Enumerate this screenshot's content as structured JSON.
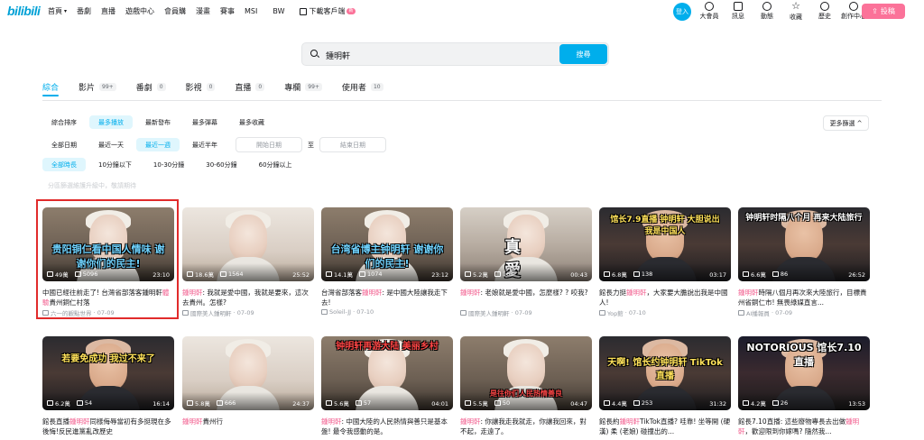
{
  "header": {
    "logo": "bilibili",
    "nav": [
      "首頁",
      "番劇",
      "直播",
      "遊戲中心",
      "會員購",
      "漫畫",
      "賽事",
      "MSI",
      "BW"
    ],
    "download": "下載客戶端",
    "download_badge": "新",
    "login": "登入",
    "right_nav": [
      "大會員",
      "訊息",
      "動態",
      "收藏",
      "歷史",
      "創作中心"
    ],
    "upload": "投稿"
  },
  "search": {
    "value": "鍾明軒",
    "button": "搜尋"
  },
  "tabs": [
    {
      "label": "綜合",
      "count": ""
    },
    {
      "label": "影片",
      "count": "99+"
    },
    {
      "label": "番劇",
      "count": "0"
    },
    {
      "label": "影視",
      "count": "0"
    },
    {
      "label": "直播",
      "count": "0"
    },
    {
      "label": "專欄",
      "count": "99+"
    },
    {
      "label": "使用者",
      "count": "10"
    }
  ],
  "filters": {
    "sort": [
      "綜合排序",
      "最多播放",
      "最新發布",
      "最多彈幕",
      "最多收藏"
    ],
    "date": [
      "全部日期",
      "最近一天",
      "最近一週",
      "最近半年"
    ],
    "date_start": "開始日期",
    "date_to": "至",
    "date_end": "結束日期",
    "duration": [
      "全部時長",
      "10分鐘以下",
      "10-30分鐘",
      "30-60分鐘",
      "60分鐘以上"
    ],
    "more": "更多篩選",
    "hint": "分區篩選維護升級中，敬請期待"
  },
  "cards_row1": [
    {
      "plays": "49萬",
      "danmaku": "5096",
      "duration": "23:10",
      "overlay": "贵阳铜仁看中国人情味 谢谢你们的民主!",
      "title_pre": "中國已經往前走了! 台灣省部落客鍾明軒",
      "title_hl": "體驗",
      "title_post": "貴州銅仁村落",
      "author": "六一的觀點世界",
      "date": "07-09"
    },
    {
      "plays": "18.6萬",
      "danmaku": "1564",
      "duration": "25:52",
      "overlay": "",
      "title_pre": "",
      "title_hl": "鍾明軒",
      "title_post": ": 我就是愛中國，我就是要來，這次去貴州。怎樣?",
      "author": "國際美人鍾明軒",
      "date": "07-09"
    },
    {
      "plays": "14.1萬",
      "danmaku": "1074",
      "duration": "23:12",
      "overlay": "台湾省博主钟明轩 谢谢你们的民主!",
      "title_pre": "台灣省部落客",
      "title_hl": "鍾明軒",
      "title_post": ": 是中國大陸讓我走下去!",
      "author": "Soleil-JJ",
      "date": "07-10"
    },
    {
      "plays": "5.2萬",
      "danmaku": "163",
      "duration": "00:43",
      "overlay": "真 愛 我的中国心",
      "title_pre": "",
      "title_hl": "鍾明軒",
      "title_post": ": 老娘就是愛中國，怎麼樣? ? 咬我?",
      "author": "國際美人鍾明軒",
      "date": "07-09"
    },
    {
      "plays": "6.8萬",
      "danmaku": "138",
      "duration": "03:17",
      "overlay": "馆长7.9直播 钟明轩 大胆说出我是中国人",
      "title_pre": "館長力挺",
      "title_hl": "鍾明軒",
      "title_post": "，大家要大膽說出我是中國人!",
      "author": "Yop館",
      "date": "07-10"
    },
    {
      "plays": "6.6萬",
      "danmaku": "86",
      "duration": "26:52",
      "overlay": "钟明轩时隔八个月 再来大陆旅行",
      "title_pre": "",
      "title_hl": "鍾明軒",
      "title_post": "時隔八個月再次來大陸旅行，目標貴州省銅仁市! 無畏綠媒直言...",
      "author": "AI播報員",
      "date": "07-09"
    }
  ],
  "cards_row2": [
    {
      "plays": "6.2萬",
      "danmaku": "54",
      "duration": "16:14",
      "overlay": "若要免成功 我过不来了",
      "title_pre": "館長直播",
      "title_hl": "鍾明軒",
      "title_post": "同樣侮辱當初有多挺現在多後悔!反民進黨亂改歷史",
      "author": "",
      "date": ""
    },
    {
      "plays": "5.8萬",
      "danmaku": "666",
      "duration": "24:37",
      "overlay": "",
      "title_pre": "",
      "title_hl": "鍾明軒",
      "title_post": "貴州行",
      "author": "",
      "date": ""
    },
    {
      "plays": "5.6萬",
      "danmaku": "57",
      "duration": "04:01",
      "overlay": "钟明轩再游大陆 美丽乡村",
      "title_pre": "",
      "title_hl": "鍾明軒",
      "title_post": ": 中國大陸的人民熱情與善只是基本盤! 最令我感動的是。",
      "author": "",
      "date": ""
    },
    {
      "plays": "5.5萬",
      "danmaku": "50",
      "duration": "04:47",
      "overlay": "是往你们人民热情善良",
      "title_pre": "",
      "title_hl": "鍾明軒",
      "title_post": ": 你讓我走我就走，你讓我回來，對不起，走遠了。",
      "author": "",
      "date": ""
    },
    {
      "plays": "4.4萬",
      "danmaku": "253",
      "duration": "31:32",
      "overlay": "天啊! 馆长约钟明轩 TikTok直播",
      "title_pre": "館長約",
      "title_hl": "鍾明軒",
      "title_post": "TikTok直播? 哇靠! 坐等開 (硬漢) 柔 (老娘) 碰撞出的...",
      "author": "",
      "date": ""
    },
    {
      "plays": "4.2萬",
      "danmaku": "26",
      "duration": "13:53",
      "overlay": "NOTORIOUS 馆长7.10直播",
      "title_pre": "館長7.10直播: 這些廢物專長去出做",
      "title_hl": "鍾明軒",
      "title_post": "，歡迎限到你嫁嗎? 隨然我...",
      "author": "",
      "date": ""
    }
  ]
}
